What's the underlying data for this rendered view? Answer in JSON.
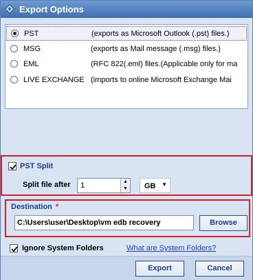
{
  "window": {
    "title": "Export Options",
    "background": "#d9e4f2",
    "title_gradient": [
      "#6f9ad2",
      "#3f6fb0"
    ]
  },
  "formats": [
    {
      "label": "PST",
      "description": "(exports as Microsoft Outlook (.pst) files.)",
      "selected": true
    },
    {
      "label": "MSG",
      "description": "(exports as Mail message (.msg) files.)",
      "selected": false
    },
    {
      "label": "EML",
      "description": "(RFC 822(.eml) files.(Applicable only for ma",
      "selected": false
    },
    {
      "label": "LIVE EXCHANGE",
      "description": "(imports to online Microsoft Exchange Mai",
      "selected": false
    }
  ],
  "pst_split": {
    "label": "PST Split",
    "checked": true,
    "split_label": "Split file after",
    "value": "1",
    "unit": "GB"
  },
  "destination": {
    "label": "Destination",
    "required_marker": "*",
    "path": "C:\\Users\\user\\Desktop\\vm edb recovery",
    "browse_label": "Browse"
  },
  "ignore_system_folders": {
    "label": "Ignore System Folders",
    "checked": true,
    "help_link": "What are System Folders?"
  },
  "footer": {
    "export_label": "Export",
    "cancel_label": "Cancel"
  },
  "colors": {
    "highlight_border": "#d0202a",
    "link": "#1a3fd0",
    "label_blue": "#1f3f8a"
  }
}
